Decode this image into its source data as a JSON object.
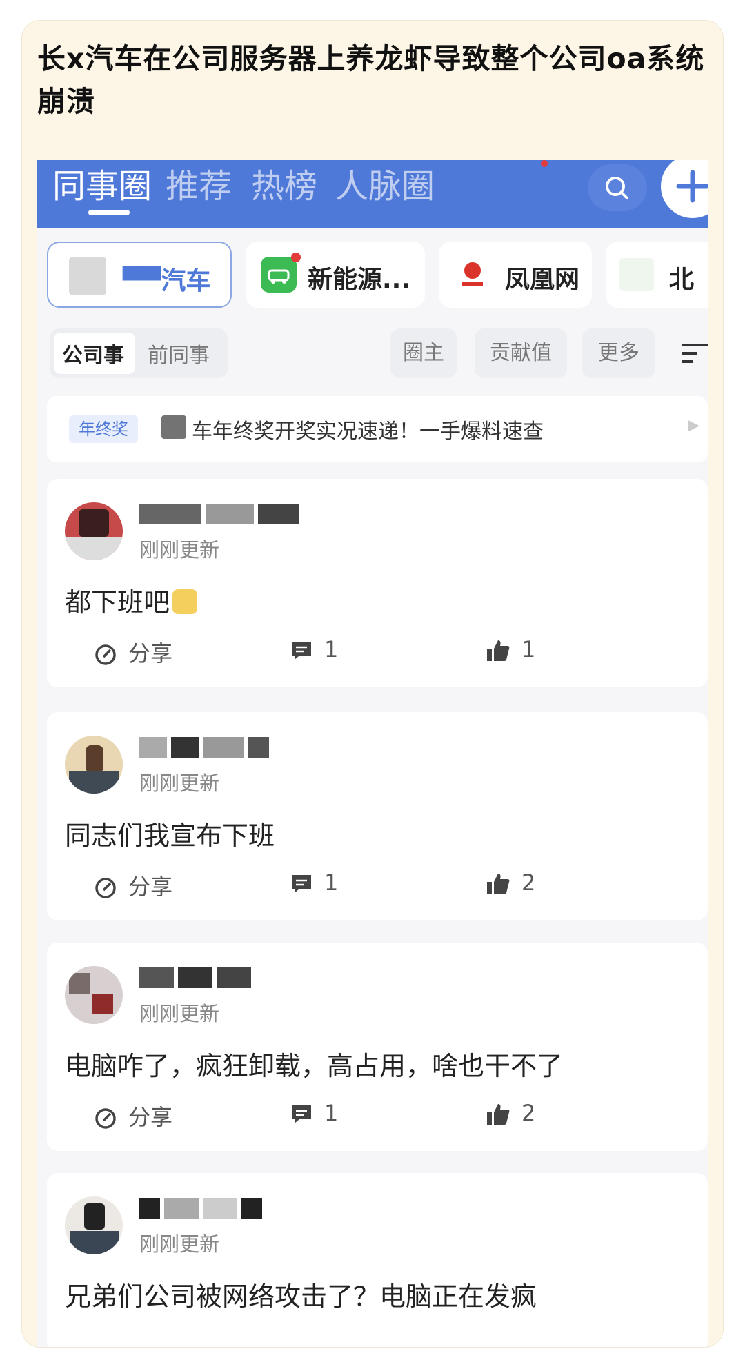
{
  "headline": "长x汽车在公司服务器上养龙虾导致整个公司oa系统崩溃",
  "nav": {
    "tabs": [
      "同事圈",
      "推荐",
      "热榜",
      "人脉圈"
    ],
    "active_tab": "同事圈"
  },
  "channels": [
    {
      "label": "▀▀汽车"
    },
    {
      "label": "新能源..."
    },
    {
      "label": "凤凰网"
    },
    {
      "label": "北"
    }
  ],
  "filters": {
    "segments": [
      "公司事",
      "前同事"
    ],
    "buttons": [
      "圈主",
      "贡献值",
      "更多"
    ]
  },
  "notice": {
    "tag": "年终奖",
    "text": "车年终奖开奖实况速递！一手爆料速查"
  },
  "posts": [
    {
      "time": "刚刚更新",
      "content": "都下班吧",
      "share": "分享",
      "comments": "1",
      "likes": "1"
    },
    {
      "time": "刚刚更新",
      "content": "同志们我宣布下班",
      "share": "分享",
      "comments": "1",
      "likes": "2"
    },
    {
      "time": "刚刚更新",
      "content": "电脑咋了，疯狂卸载，高占用，啥也干不了",
      "share": "分享",
      "comments": "1",
      "likes": "2"
    },
    {
      "time": "刚刚更新",
      "content": "兄弟们公司被网络攻击了？电脑正在发疯"
    }
  ],
  "colors": {
    "brand_blue": "#4f79d8",
    "card_background": "#fdf6e7"
  }
}
